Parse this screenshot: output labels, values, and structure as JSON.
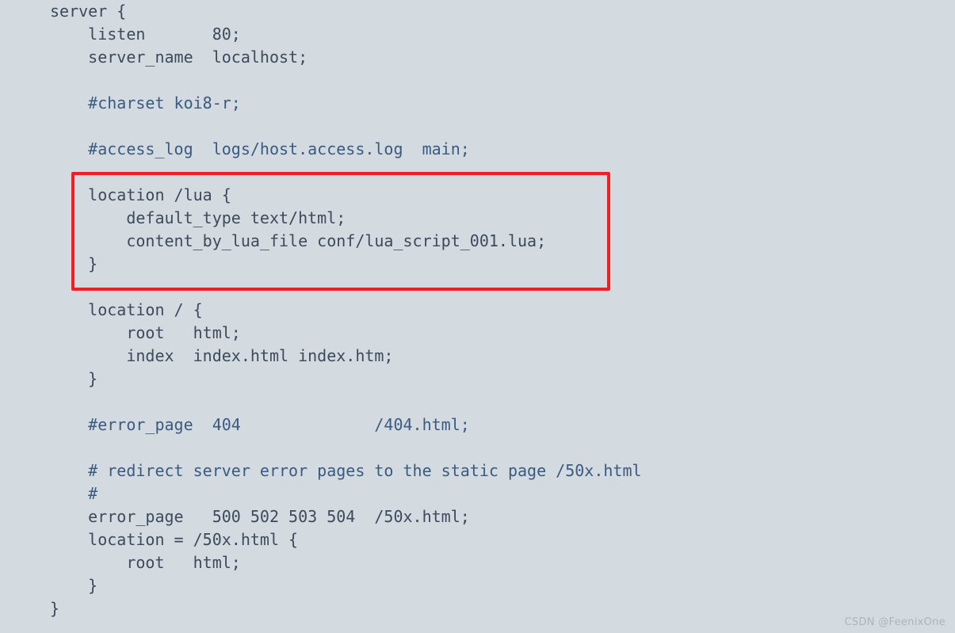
{
  "document": {
    "kind": "nginx-config-snippet",
    "background_color": "#d3dae0",
    "code_color": "#3d4a5c",
    "comment_color": "#3a5a80",
    "highlight_color": "#ee2024"
  },
  "code": {
    "lines": [
      {
        "text": "server {",
        "type": "code"
      },
      {
        "text": "    listen       80;",
        "type": "code"
      },
      {
        "text": "    server_name  localhost;",
        "type": "code"
      },
      {
        "text": "",
        "type": "blank"
      },
      {
        "text": "    #charset koi8-r;",
        "type": "comment"
      },
      {
        "text": "",
        "type": "blank"
      },
      {
        "text": "    #access_log  logs/host.access.log  main;",
        "type": "comment"
      },
      {
        "text": "",
        "type": "blank"
      },
      {
        "text": "    location /lua {",
        "type": "code"
      },
      {
        "text": "        default_type text/html;",
        "type": "code"
      },
      {
        "text": "        content_by_lua_file conf/lua_script_001.lua;",
        "type": "code"
      },
      {
        "text": "    }",
        "type": "code"
      },
      {
        "text": "",
        "type": "blank"
      },
      {
        "text": "    location / {",
        "type": "code"
      },
      {
        "text": "        root   html;",
        "type": "code"
      },
      {
        "text": "        index  index.html index.htm;",
        "type": "code"
      },
      {
        "text": "    }",
        "type": "code"
      },
      {
        "text": "",
        "type": "blank"
      },
      {
        "text": "    #error_page  404              /404.html;",
        "type": "comment"
      },
      {
        "text": "",
        "type": "blank"
      },
      {
        "text": "    # redirect server error pages to the static page /50x.html",
        "type": "comment"
      },
      {
        "text": "    #",
        "type": "comment"
      },
      {
        "text": "    error_page   500 502 503 504  /50x.html;",
        "type": "code"
      },
      {
        "text": "    location = /50x.html {",
        "type": "code"
      },
      {
        "text": "        root   html;",
        "type": "code"
      },
      {
        "text": "    }",
        "type": "code"
      },
      {
        "text": "}",
        "type": "code"
      }
    ]
  },
  "annotation": {
    "name": "lua-location-highlight",
    "target_block": "location /lua",
    "color": "#ee2024"
  },
  "watermark": {
    "text": "CSDN @FeenixOne"
  }
}
